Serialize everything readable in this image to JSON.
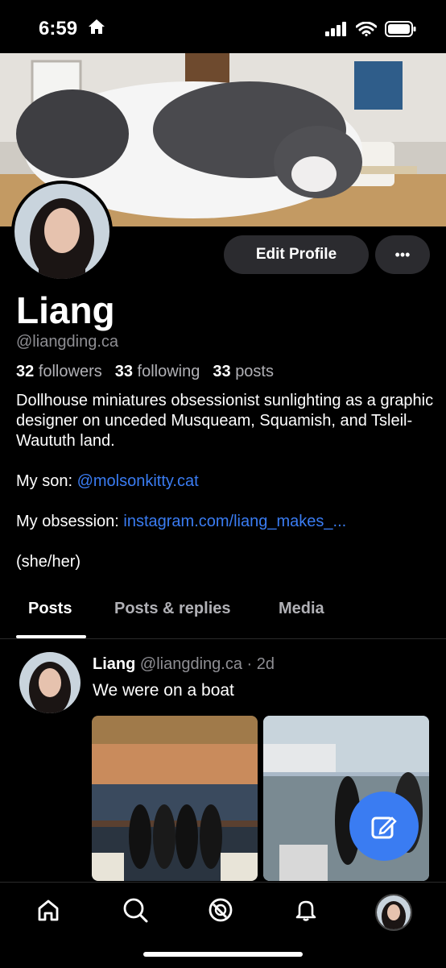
{
  "status": {
    "time": "6:59"
  },
  "actions": {
    "edit_profile": "Edit Profile",
    "more": "•••"
  },
  "profile": {
    "name": "Liang",
    "handle": "@liangding.ca",
    "followers_count": "32",
    "followers_label": "followers",
    "following_count": "33",
    "following_label": "following",
    "posts_count": "33",
    "posts_label": "posts",
    "bio_line1": "Dollhouse miniatures obsessionist sunlighting as a graphic designer on unceded Musqueam, Squamish, and Tsleil-Waututh land.",
    "son_label": "My son: ",
    "son_link": "@molsonkitty.cat",
    "obsession_label": "My obsession: ",
    "obsession_link": "instagram.com/liang_makes_...",
    "pronouns": "(she/her)"
  },
  "tabs": [
    {
      "label": "Posts",
      "active": true
    },
    {
      "label": "Posts & replies",
      "active": false
    },
    {
      "label": "Media",
      "active": false
    }
  ],
  "post": {
    "author": "Liang",
    "handle": "@liangding.ca",
    "separator": " · ",
    "time": "2d",
    "text": "We were on a boat"
  },
  "nav": [
    "home-icon",
    "search-icon",
    "feeds-icon",
    "notifications-icon",
    "profile-avatar"
  ],
  "colors": {
    "accent": "#3a7cf2",
    "background": "#000000",
    "button": "#2b2b2f"
  }
}
